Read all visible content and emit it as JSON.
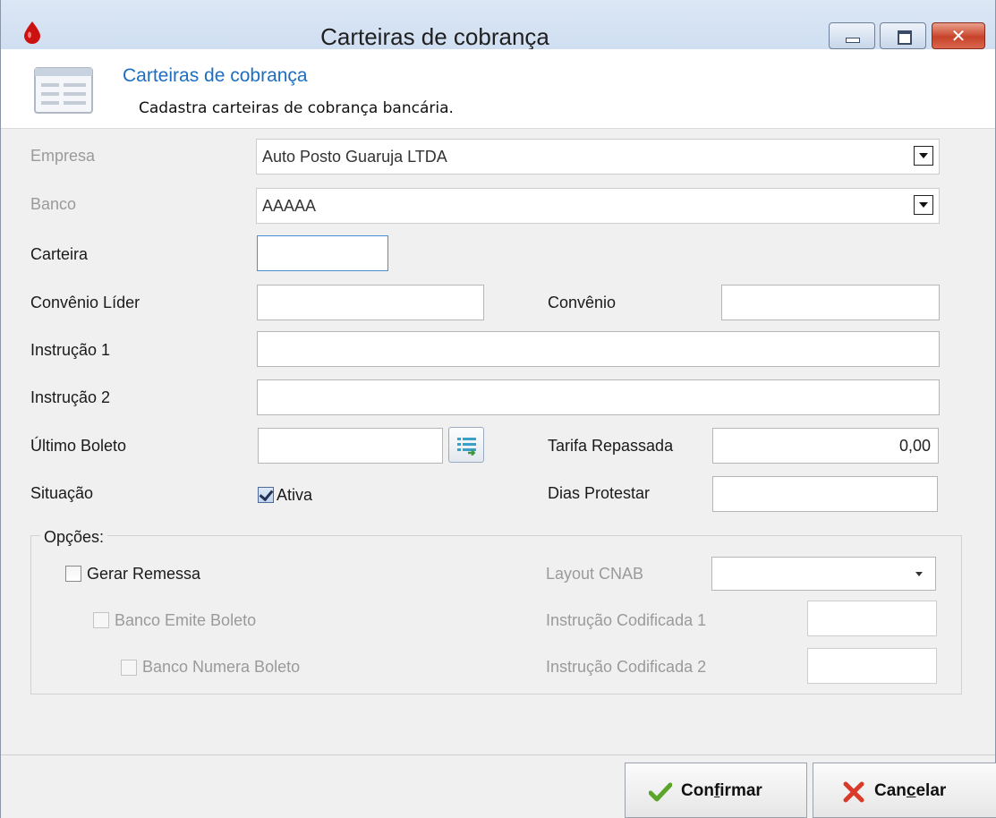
{
  "window": {
    "title": "Carteiras de cobrança",
    "close_glyph": "✕",
    "icons": {
      "app": "water-drop-icon",
      "minimize": "minimize-icon",
      "maximize": "maximize-icon",
      "close": "close-icon"
    }
  },
  "header": {
    "title": "Carteiras de cobrança",
    "subtitle": "Cadastra carteiras de cobrança bancária.",
    "icon": "form-list-icon"
  },
  "form": {
    "empresa": {
      "label": "Empresa",
      "value": "Auto Posto Guaruja LTDA"
    },
    "banco": {
      "label": "Banco",
      "value": "AAAAA"
    },
    "carteira": {
      "label": "Carteira",
      "value": ""
    },
    "convenio_lider": {
      "label": "Convênio Líder",
      "value": ""
    },
    "convenio": {
      "label": "Convênio",
      "value": ""
    },
    "instrucao1": {
      "label": "Instrução 1",
      "value": ""
    },
    "instrucao2": {
      "label": "Instrução 2",
      "value": ""
    },
    "ultimo_boleto": {
      "label": "Último Boleto",
      "value": ""
    },
    "tarifa_repassada": {
      "label": "Tarifa Repassada",
      "value": "0,00"
    },
    "situacao": {
      "label": "Situação",
      "checkbox_label": "Ativa",
      "checked": true
    },
    "dias_protestar": {
      "label": "Dias Protestar",
      "value": ""
    }
  },
  "opcoes": {
    "legend": "Opções:",
    "gerar_remessa": {
      "label": "Gerar Remessa",
      "checked": false
    },
    "banco_emite_boleto": {
      "label": "Banco Emite Boleto",
      "checked": false
    },
    "banco_numera_boleto": {
      "label": "Banco Numera Boleto",
      "checked": false
    },
    "layout_cnab": {
      "label": "Layout CNAB",
      "value": ""
    },
    "instrucao_codificada1": {
      "label": "Instrução Codificada 1",
      "value": ""
    },
    "instrucao_codificada2": {
      "label": "Instrução Codificada 2",
      "value": ""
    }
  },
  "actions": {
    "confirm": {
      "pre": "Con",
      "mnemonic": "f",
      "post": "irmar",
      "icon": "checkmark-icon"
    },
    "cancel": {
      "pre": "Can",
      "mnemonic": "c",
      "post": "elar",
      "icon": "x-icon"
    }
  },
  "colors": {
    "header_title": "#1c6ec2",
    "focus_border": "#4a8fd6",
    "confirm_icon": "#5aa52a",
    "cancel_icon": "#d93a2a"
  }
}
